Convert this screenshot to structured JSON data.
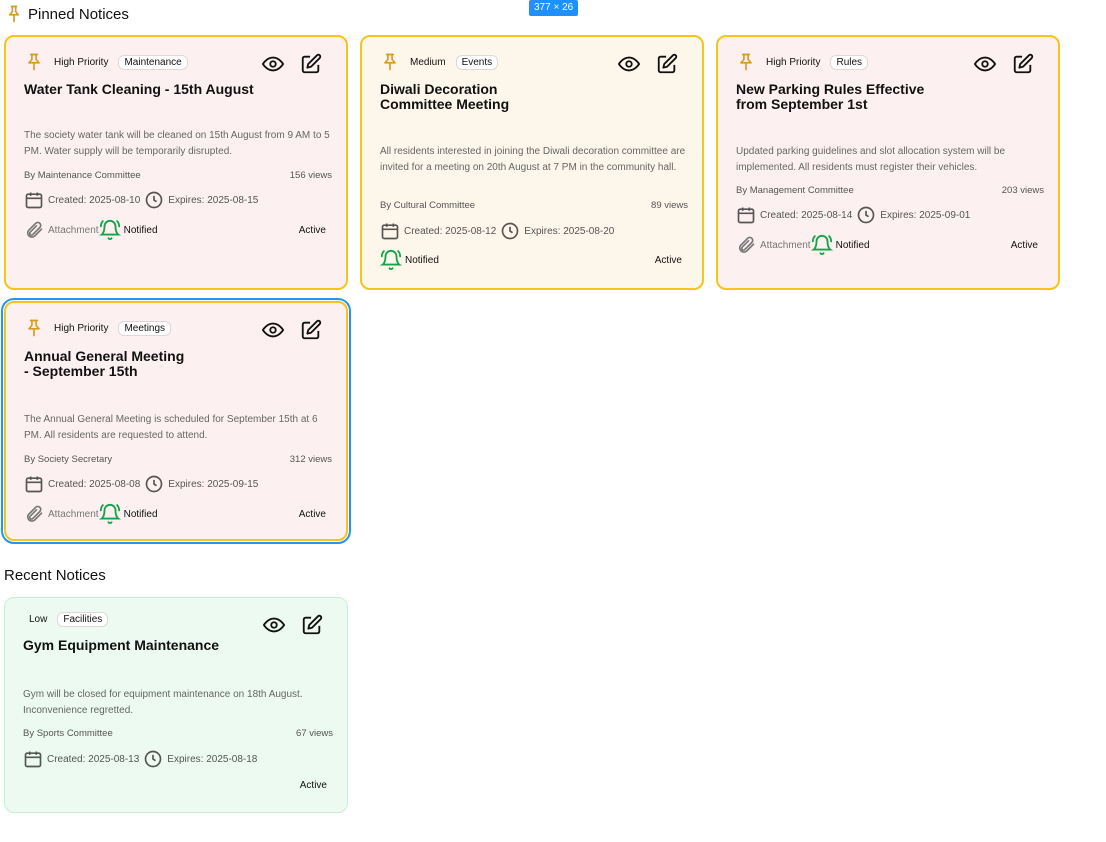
{
  "pinned_title": "Pinned Notices",
  "recent_title": "Recent Notices",
  "dimension_badge": "377 × 26",
  "cards": [
    {
      "priority": "High Priority",
      "category": "Maintenance",
      "title": "Water Tank Cleaning - 15th August",
      "description": "The society water tank will be cleaned on 15th August from 9 AM to 5 PM. Water supply will be temporarily disrupted.",
      "author": "By Maintenance Committee",
      "views": "156 views",
      "created": "Created: 2025-08-10",
      "expires": "Expires: 2025-08-15",
      "attachment": "Attachment",
      "notified": "Notified",
      "status": "Active"
    },
    {
      "priority": "Medium",
      "category": "Events",
      "title_line1": "Diwali Decoration",
      "title_line2": "Committee Meeting",
      "description": "All residents interested in joining the Diwali decoration committee are invited for a meeting on 20th August at 7 PM in the community hall.",
      "author": "By Cultural Committee",
      "views": "89 views",
      "created": "Created: 2025-08-12",
      "expires": "Expires: 2025-08-20",
      "notified": "Notified",
      "status": "Active"
    },
    {
      "priority": "High Priority",
      "category": "Rules",
      "title_line1": "New Parking Rules Effective",
      "title_line2": "from September 1st",
      "description": "Updated parking guidelines and slot allocation system will be implemented. All residents must register their vehicles.",
      "author": "By Management Committee",
      "views": "203 views",
      "created": "Created: 2025-08-14",
      "expires": "Expires: 2025-09-01",
      "attachment": "Attachment",
      "notified": "Notified",
      "status": "Active"
    },
    {
      "priority": "High Priority",
      "category": "Meetings",
      "title_line1": "Annual General Meeting",
      "title_line2": "- September 15th",
      "description": "The Annual General Meeting is scheduled for September 15th at 6 PM. All residents are requested to attend.",
      "author": "By Society Secretary",
      "views": "312 views",
      "created": "Created: 2025-08-08",
      "expires": "Expires: 2025-09-15",
      "attachment": "Attachment",
      "notified": "Notified",
      "status": "Active"
    },
    {
      "priority": "Low",
      "category": "Facilities",
      "title": "Gym Equipment Maintenance",
      "description": "Gym will be closed for equipment maintenance on 18th August. Inconvenience regretted.",
      "author": "By Sports Committee",
      "views": "67 views",
      "created": "Created: 2025-08-13",
      "expires": "Expires: 2025-08-18",
      "status": "Active"
    }
  ],
  "colors": {
    "pinned_border": "#f5c518",
    "high_bg": "#fdf0f0",
    "medium_bg": "#fdf6ea",
    "low_bg": "#ecfaf1",
    "bell_green": "#16a34a",
    "pin_orange": "#d99a1e",
    "selection_blue": "#2196f3"
  },
  "icons": [
    "pin-icon",
    "eye-icon",
    "edit-icon",
    "calendar-icon",
    "clock-icon",
    "paperclip-icon",
    "bell-icon"
  ]
}
